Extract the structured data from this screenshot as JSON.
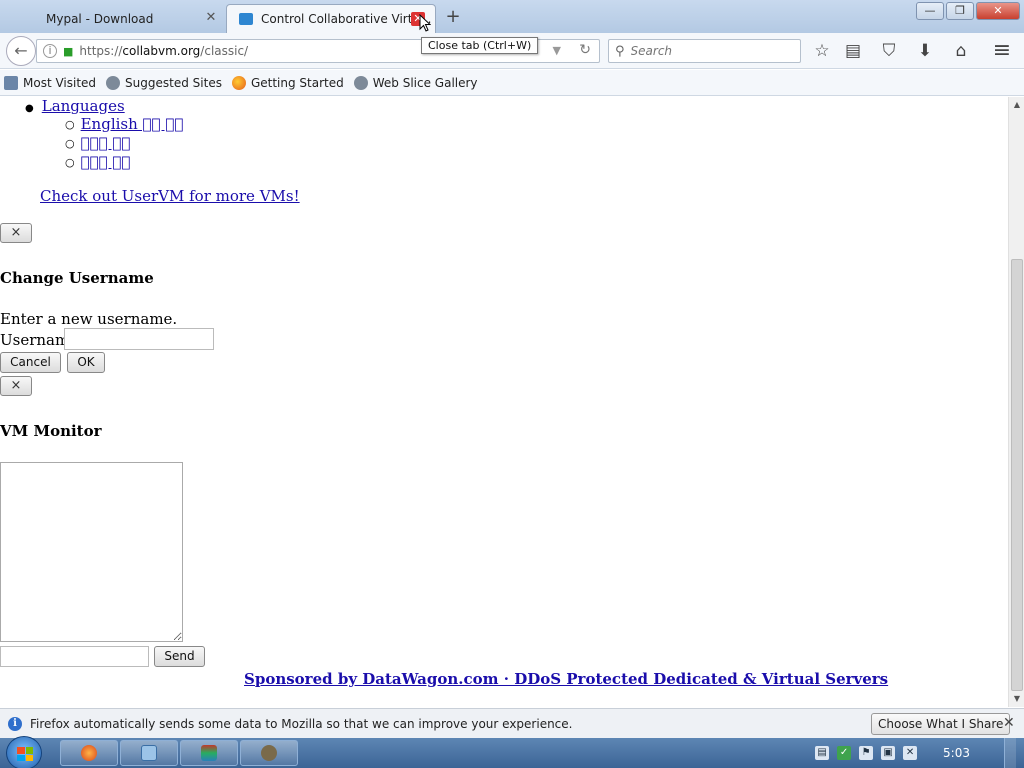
{
  "window": {
    "tabs": [
      {
        "label": "Mypal - Download",
        "close": "✕"
      },
      {
        "label": "Control Collaborative Virtu...",
        "close": "✕"
      }
    ],
    "new_tab": "+",
    "min": "—",
    "max": "❐",
    "close": "✕"
  },
  "navbar": {
    "back": "←",
    "url_scheme": "https://",
    "url_host": "collabvm.org",
    "url_path": "/classic/",
    "dropdown": "▼",
    "reload": "↻",
    "search_placeholder": "Search",
    "search_glyph": "⚲",
    "tooltip": "Close tab (Ctrl+W)",
    "icons": {
      "bookmark_star": "☆",
      "reading_list": "▤",
      "pocket": "⛉",
      "download": "⬇",
      "home": "⌂",
      "menu": "≡"
    }
  },
  "bookmarks": [
    "Most Visited",
    "Suggested Sites",
    "Getting Started",
    "Web Slice Gallery"
  ],
  "content": {
    "languages_link": "Languages",
    "language_items": [
      "English ￿￿ ￿￿",
      "￿￿￿ ￿￿",
      "￿￿￿ ￿￿"
    ],
    "uservm_link": "Check out UserVM for more VMs!",
    "dialog_close": "×",
    "change_username_title": "Change Username",
    "change_username_text": "Enter a new username.",
    "username_label": "Username",
    "cancel_label": "Cancel",
    "ok_label": "OK",
    "vm_monitor_title": "VM Monitor",
    "send_label": "Send",
    "sponsor_text": "Sponsored by DataWagon.com · DDoS Protected Dedicated & Virtual Servers"
  },
  "scrollbar": {
    "up": "▲",
    "down": "▼"
  },
  "notification": {
    "text": "Firefox automatically sends some data to Mozilla so that we can improve your experience.",
    "button": "Choose What I Share",
    "close": "✕"
  },
  "taskbar": {
    "clock": "5:03"
  }
}
